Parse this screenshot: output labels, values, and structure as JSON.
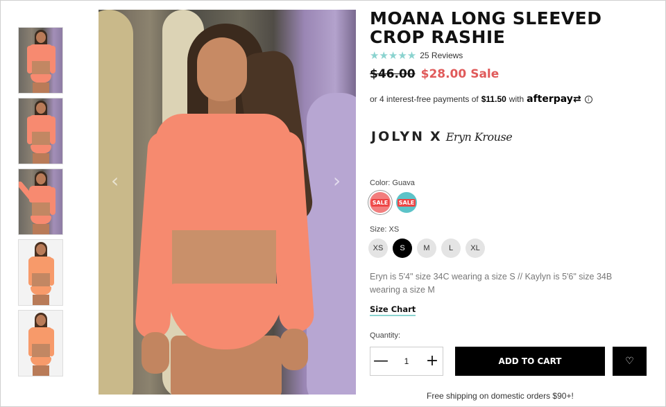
{
  "product": {
    "title": "MOANA LONG SLEEVED CROP RASHIE",
    "stars": "★★★★★",
    "reviews": "25 Reviews",
    "original_price": "$46.00",
    "sale_price": "$28.00",
    "sale_label": "Sale"
  },
  "afterpay": {
    "prefix": "or 4 interest-free payments of",
    "amount": "$11.50",
    "with": "with",
    "logo": "afterpay",
    "logo_arrow": "⇄",
    "info_icon": "i"
  },
  "collab": {
    "brand": "JOLYN",
    "x": "X",
    "signature": "Eryn Krouse"
  },
  "color": {
    "label": "Color: Guava",
    "swatches": [
      {
        "name": "Guava",
        "color": "#f27e7e",
        "tag": "SALE",
        "selected": true
      },
      {
        "name": "Teal",
        "color": "#5cc3c8",
        "tag": "SALE",
        "selected": false
      }
    ]
  },
  "size": {
    "label": "Size: XS",
    "options": [
      "XS",
      "S",
      "M",
      "L",
      "XL"
    ],
    "selected": "S"
  },
  "fit_note": "Eryn is 5'4\" size 34C wearing a size S // Kaylyn is 5'6\" size 34B wearing a size M",
  "size_chart": "Size Chart",
  "quantity": {
    "label": "Quantity:",
    "value": "1",
    "minus": "—",
    "plus": "+"
  },
  "add_to_cart": "ADD TO CART",
  "wishlist_icon": "♡",
  "shipping": "Free shipping on domestic orders $90+!",
  "gallery": {
    "prev": "‹",
    "next": "›"
  },
  "colors": {
    "accent_teal": "#8ad3cf",
    "sale_red": "#e05a5a",
    "swimsuit": "#f68a6f"
  }
}
